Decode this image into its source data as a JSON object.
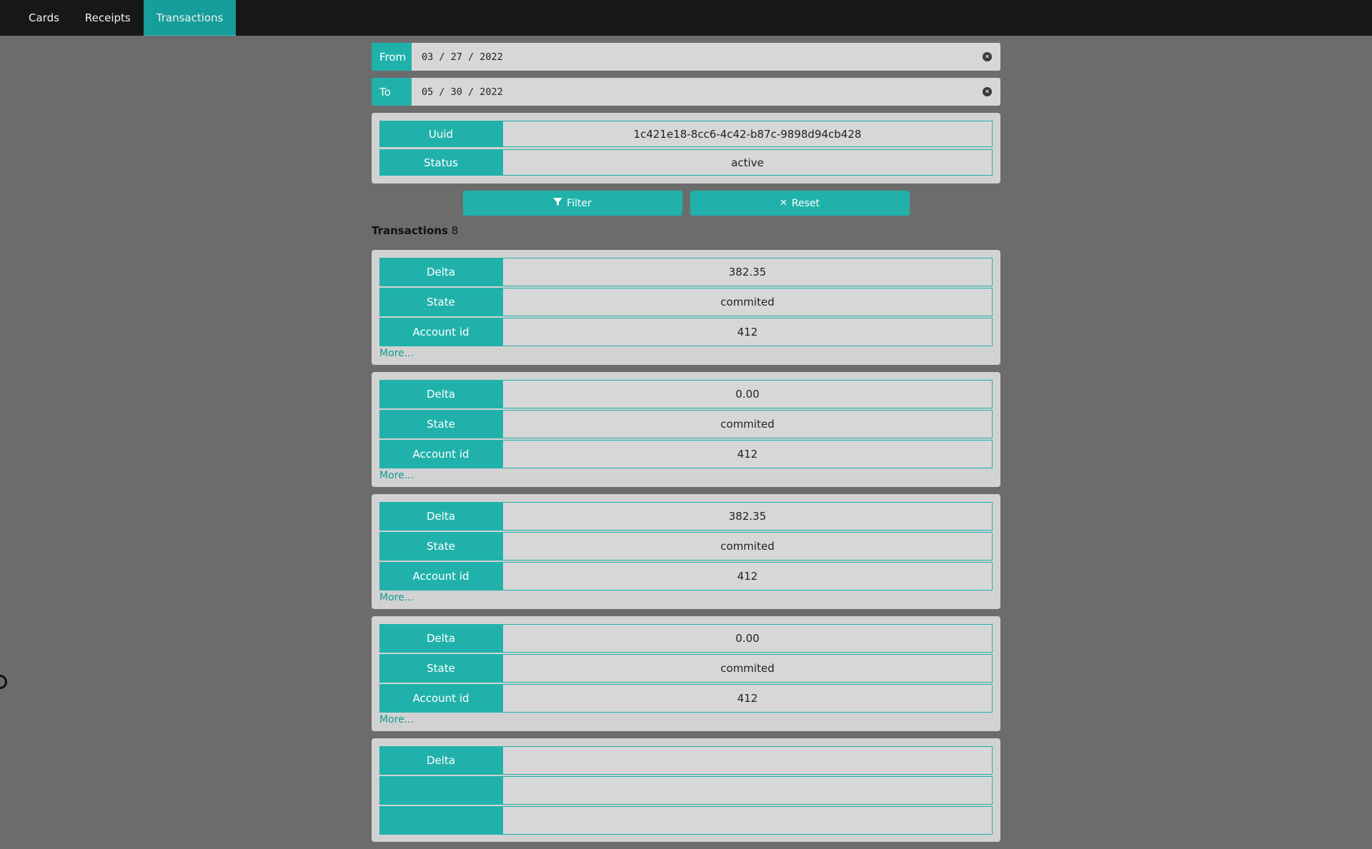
{
  "nav": {
    "items": [
      {
        "label": "Cards"
      },
      {
        "label": "Receipts"
      },
      {
        "label": "Transactions"
      }
    ],
    "active": "Transactions"
  },
  "filters": {
    "from_label": "From",
    "from_value": "03 / 27 / 2022",
    "to_label": "To",
    "to_value": "05 / 30 / 2022"
  },
  "card_filter": {
    "uuid_label": "Uuid",
    "uuid_value": "1c421e18-8cc6-4c42-b87c-9898d94cb428",
    "status_label": "Status",
    "status_value": "active"
  },
  "actions": {
    "filter_label": "Filter",
    "reset_label": "Reset"
  },
  "transactions_header": {
    "label": "Transactions",
    "count": "8"
  },
  "transactions": [
    {
      "delta_label": "Delta",
      "delta": "382.35",
      "state_label": "State",
      "state": "commited",
      "account_label": "Account id",
      "account_id": "412",
      "more": "More..."
    },
    {
      "delta_label": "Delta",
      "delta": "0.00",
      "state_label": "State",
      "state": "commited",
      "account_label": "Account id",
      "account_id": "412",
      "more": "More..."
    },
    {
      "delta_label": "Delta",
      "delta": "382.35",
      "state_label": "State",
      "state": "commited",
      "account_label": "Account id",
      "account_id": "412",
      "more": "More..."
    },
    {
      "delta_label": "Delta",
      "delta": "0.00",
      "state_label": "State",
      "state": "commited",
      "account_label": "Account id",
      "account_id": "412",
      "more": "More..."
    },
    {
      "delta_label": "Delta",
      "delta": "",
      "state_label": "",
      "state": "",
      "account_label": "",
      "account_id": "",
      "more": ""
    }
  ],
  "colors": {
    "accent": "#20b2aa",
    "nav_bg": "#171717",
    "page_bg": "#6c6c6c",
    "card_bg": "#d2d2d2"
  }
}
